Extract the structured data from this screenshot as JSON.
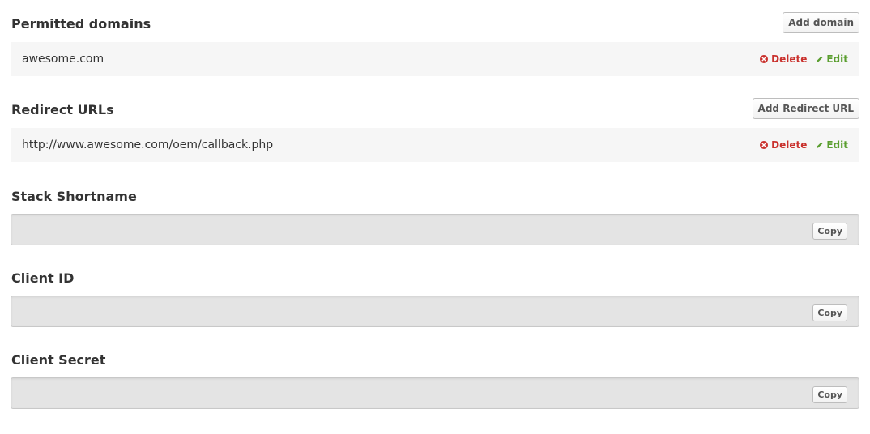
{
  "permitted_domains": {
    "title": "Permitted domains",
    "add_label": "Add domain",
    "items": [
      {
        "value": "awesome.com",
        "delete_label": "Delete",
        "edit_label": "Edit"
      }
    ]
  },
  "redirect_urls": {
    "title": "Redirect URLs",
    "add_label": "Add Redirect URL",
    "items": [
      {
        "value": "http://www.awesome.com/oem/callback.php",
        "delete_label": "Delete",
        "edit_label": "Edit"
      }
    ]
  },
  "stack_shortname": {
    "title": "Stack Shortname",
    "value": "",
    "copy_label": "Copy"
  },
  "client_id": {
    "title": "Client ID",
    "value": "",
    "copy_label": "Copy"
  },
  "client_secret": {
    "title": "Client Secret",
    "value": "",
    "copy_label": "Copy"
  },
  "colors": {
    "delete": "#c9302c",
    "edit": "#5a9e2f",
    "row_background": "#f6f6f6",
    "field_background": "#e4e4e4"
  },
  "icons": {
    "delete": "circle-x-icon",
    "edit": "pencil-icon"
  }
}
